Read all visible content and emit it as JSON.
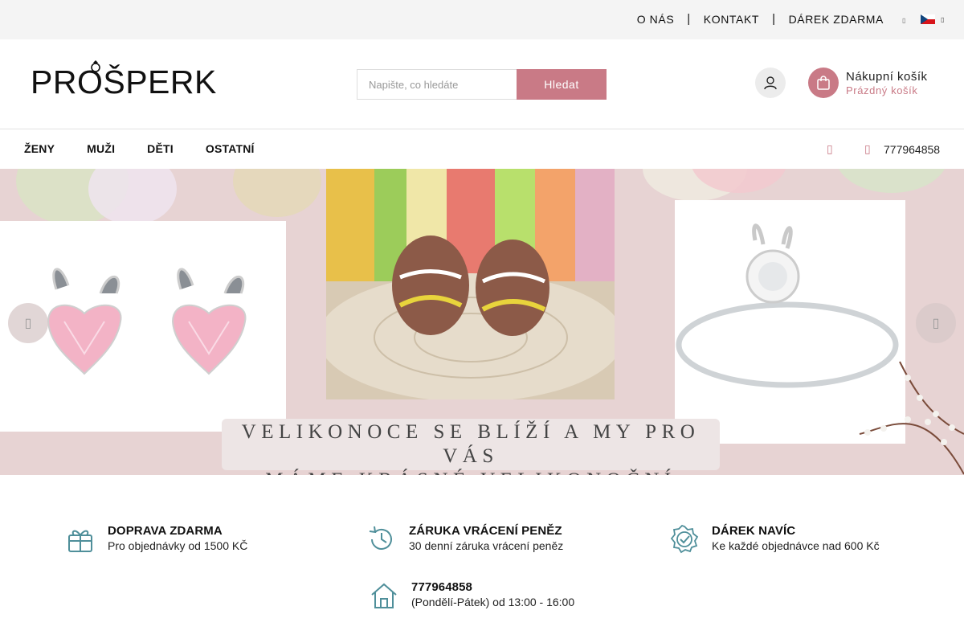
{
  "topbar": {
    "links": [
      "O NÁS",
      "KONTAKT",
      "DÁREK ZDARMA"
    ],
    "separator": "|",
    "small_icon": "▯",
    "flag_caret": "▯"
  },
  "header": {
    "logo_text_a": "PRO",
    "logo_text_b": "ŠPERK",
    "search_placeholder": "Napište, co hledáte",
    "search_button": "Hledat",
    "cart_title": "Nákupní košík",
    "cart_status": "Prázdný košík"
  },
  "nav": {
    "items": [
      "ŽENY",
      "MUŽI",
      "DĚTI",
      "OSTATNÍ"
    ],
    "heart_glyph": "▯",
    "phone_glyph": "▯",
    "phone": "777964858"
  },
  "banner": {
    "caption_line1": "VELIKONOCE SE BLÍŽÍ A MY PRO VÁS",
    "caption_line2": "MÁME KRÁSNÉ VELIKONOČNÍ ŠPERKY",
    "prev_glyph": "▯",
    "next_glyph": "▯"
  },
  "features": [
    {
      "title": "DOPRAVA ZDARMA",
      "subtitle": "Pro objednávky od 1500 KČ",
      "icon": "gift-icon"
    },
    {
      "title": "ZÁRUKA VRÁCENÍ PENĚZ",
      "subtitle": "30 denní záruka vrácení peněz",
      "icon": "history-icon"
    },
    {
      "title": "DÁREK NAVÍC",
      "subtitle": "Ke každé objednávce nad 600 Kč",
      "icon": "badge-check-icon"
    },
    {
      "title": "777964858",
      "subtitle": "(Pondělí-Pátek) od 13:00 - 16:00",
      "icon": "home-icon"
    }
  ],
  "colors": {
    "accent": "#c97a86",
    "icon_teal": "#4f8f9a",
    "banner_bg": "#e7d3d3"
  }
}
